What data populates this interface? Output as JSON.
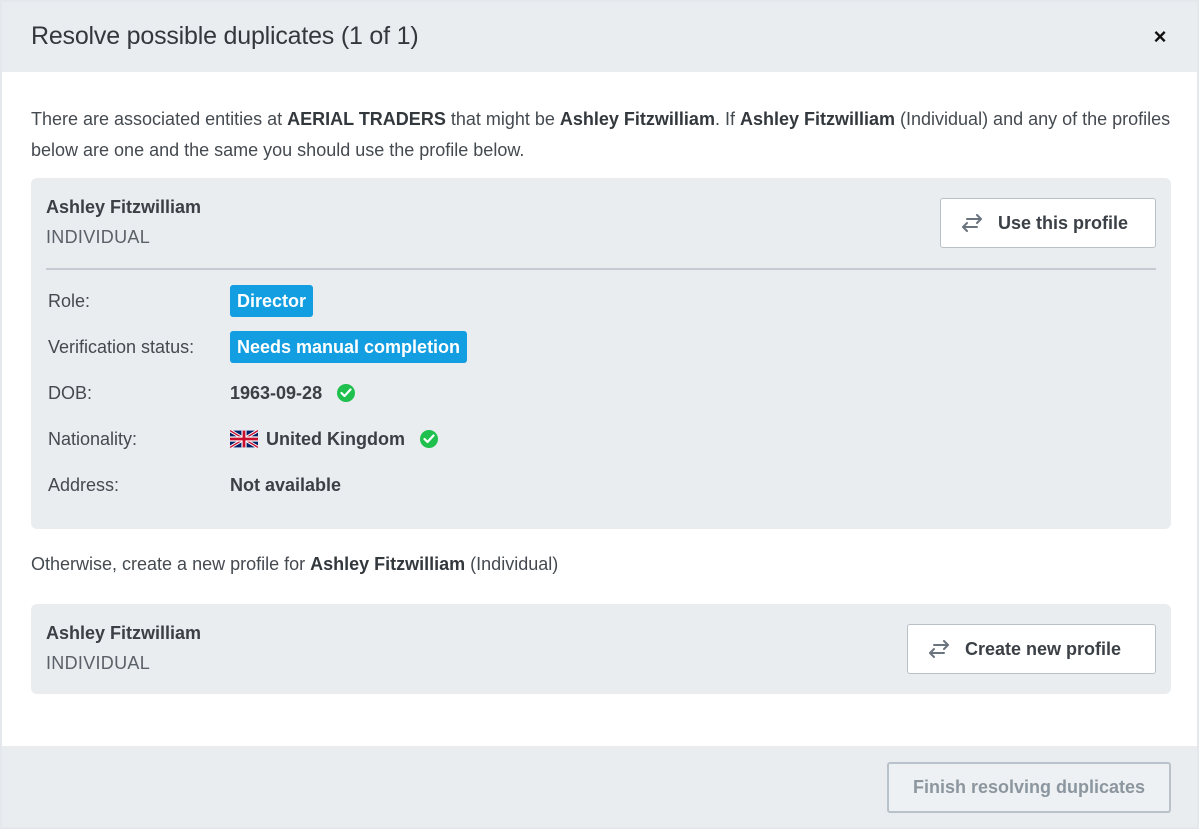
{
  "dialog": {
    "title": "Resolve possible duplicates (1 of 1)",
    "close_label": "×"
  },
  "intro": {
    "p1": "There are associated entities at ",
    "company": "AERIAL TRADERS",
    "p2": " that might be ",
    "name1": "Ashley Fitzwilliam",
    "p3": ". If ",
    "name2": "Ashley Fitzwilliam",
    "p4": " (Individual) and any of the profiles below are one and the same you should use the profile below."
  },
  "existing_profile": {
    "name": "Ashley Fitzwilliam",
    "type": "INDIVIDUAL",
    "use_button_label": "Use this profile",
    "fields": {
      "role_label": "Role:",
      "role_value": "Director",
      "verification_label": "Verification status:",
      "verification_value": "Needs manual completion",
      "dob_label": "DOB:",
      "dob_value": "1963-09-28",
      "nationality_label": "Nationality:",
      "nationality_value": "United Kingdom",
      "address_label": "Address:",
      "address_value": "Not available"
    }
  },
  "otherwise": {
    "prefix": "Otherwise, create a new profile for ",
    "name": "Ashley Fitzwilliam",
    "suffix": " (Individual)"
  },
  "new_profile": {
    "name": "Ashley Fitzwilliam",
    "type": "INDIVIDUAL",
    "create_button_label": "Create new profile"
  },
  "footer": {
    "finish_button_label": "Finish resolving duplicates"
  },
  "colors": {
    "badge_blue": "#129ee0",
    "check_green": "#1fc04e",
    "panel_gray": "#e9edf0"
  },
  "icons": {
    "swap": "swap-arrows-icon",
    "close": "close-icon",
    "check": "check-circle-icon",
    "flag": "uk-flag-icon"
  }
}
